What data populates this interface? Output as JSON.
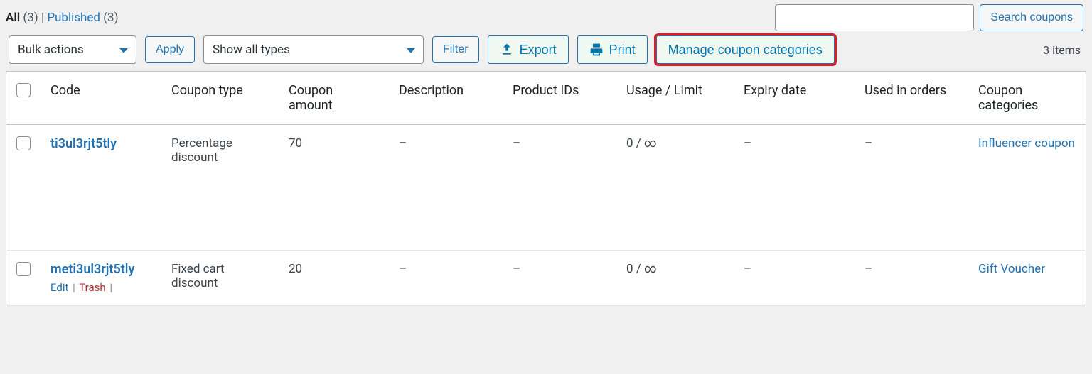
{
  "filters": {
    "all_label": "All",
    "all_count": "(3)",
    "published_label": "Published",
    "published_count": "(3)"
  },
  "search": {
    "button": "Search coupons",
    "placeholder": ""
  },
  "toolbar": {
    "bulk_select": "Bulk actions",
    "apply": "Apply",
    "type_select": "Show all types",
    "filter": "Filter",
    "export": "Export",
    "print": "Print",
    "manage_categories": "Manage coupon categories",
    "item_count": "3 items"
  },
  "columns": {
    "code": "Code",
    "type": "Coupon type",
    "amount": "Coupon amount",
    "description": "Description",
    "product_ids": "Product IDs",
    "usage": "Usage / Limit",
    "expiry": "Expiry date",
    "used_in": "Used in orders",
    "categories": "Coupon categories"
  },
  "row_actions": {
    "edit": "Edit",
    "trash": "Trash"
  },
  "rows": [
    {
      "code": "ti3ul3rjt5tly",
      "type": "Percentage discount",
      "amount": "70",
      "description": "–",
      "product_ids": "–",
      "usage": "0 / ∞",
      "expiry": "–",
      "used_in": "–",
      "categories": "Influencer coupon"
    },
    {
      "code": "meti3ul3rjt5tly",
      "type": "Fixed cart discount",
      "amount": "20",
      "description": "–",
      "product_ids": "–",
      "usage": "0 / ∞",
      "expiry": "–",
      "used_in": "–",
      "categories": "Gift Voucher"
    }
  ]
}
